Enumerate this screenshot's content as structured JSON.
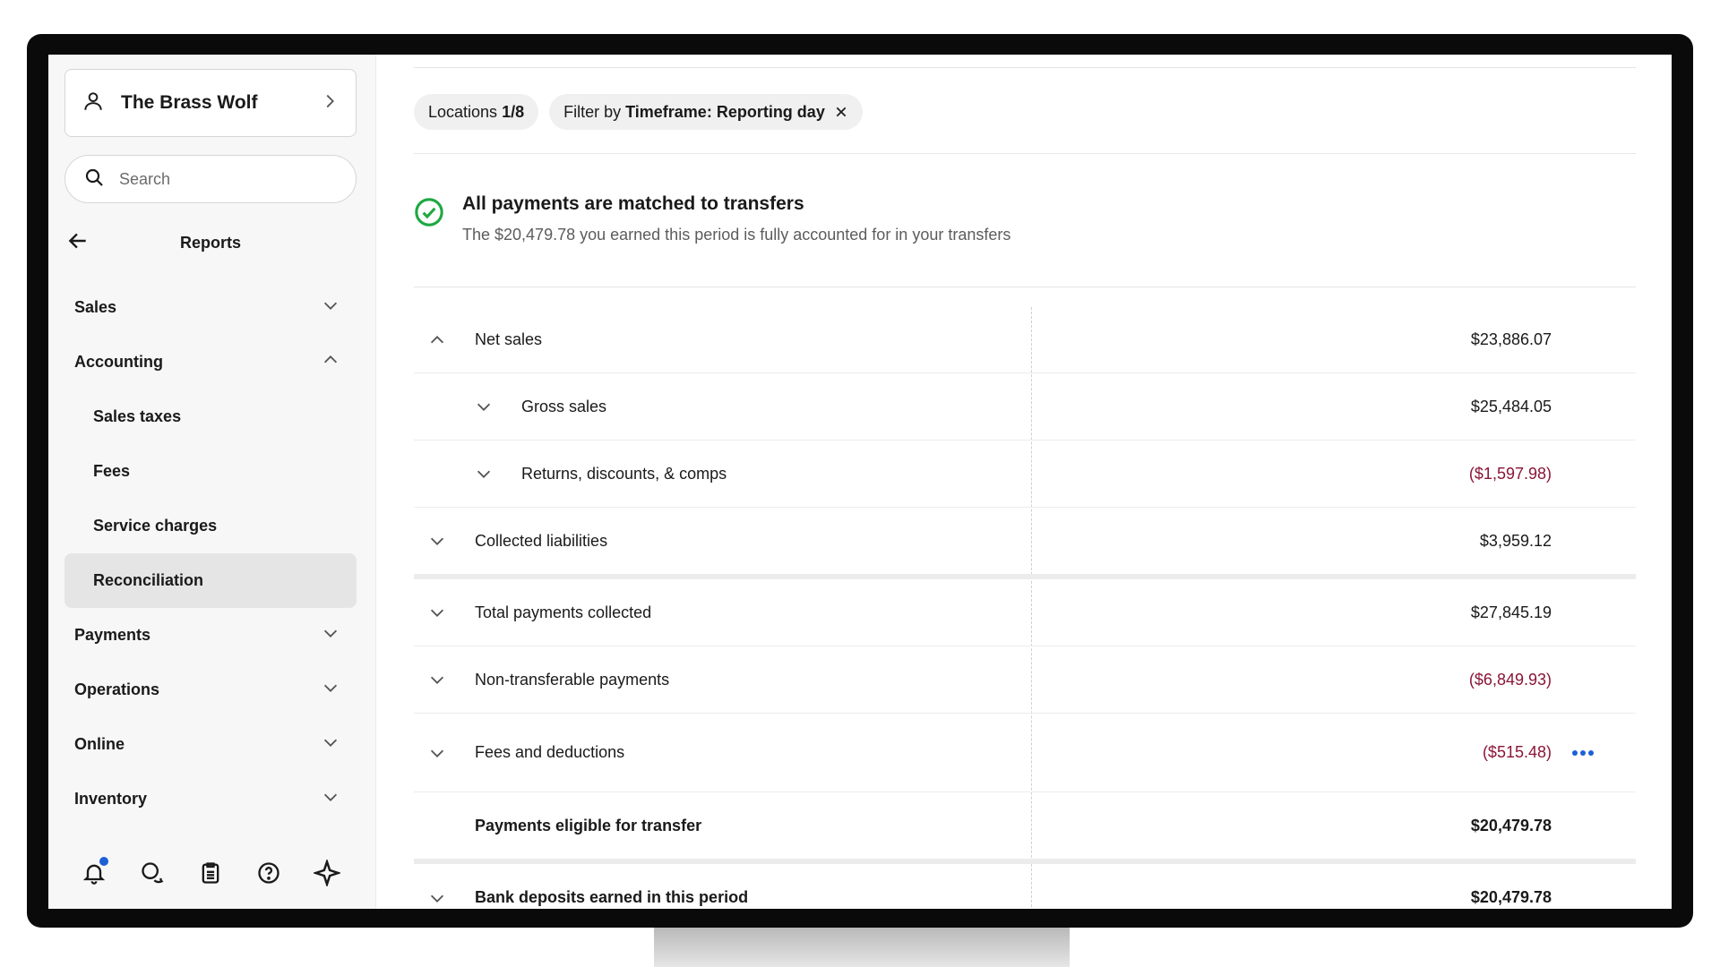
{
  "business": {
    "name": "The Brass Wolf"
  },
  "search": {
    "placeholder": "Search"
  },
  "reports": {
    "title": "Reports"
  },
  "nav": {
    "sales": "Sales",
    "accounting": "Accounting",
    "sub": [
      "Sales taxes",
      "Fees",
      "Service charges",
      "Reconciliation"
    ],
    "payments": "Payments",
    "operations": "Operations",
    "online": "Online",
    "inventory": "Inventory"
  },
  "filters": {
    "locations_label": "Locations",
    "locations_value": "1/8",
    "filter_prefix": "Filter by",
    "filter_value": "Timeframe: Reporting day"
  },
  "banner": {
    "title": "All payments are matched to transfers",
    "subtitle": "The $20,479.78 you earned this period is fully accounted for in your transfers",
    "status_color": "#1fa842"
  },
  "rows": [
    {
      "label": "Net sales",
      "amount": "$23,886.07"
    },
    {
      "label": "Gross sales",
      "amount": "$25,484.05"
    },
    {
      "label": "Returns, discounts, & comps",
      "amount": "($1,597.98)"
    },
    {
      "label": "Collected liabilities",
      "amount": "$3,959.12"
    },
    {
      "label": "Total payments collected",
      "amount": "$27,845.19"
    },
    {
      "label": "Non-transferable payments",
      "amount": "($6,849.93)"
    },
    {
      "label": "Fees and deductions",
      "amount": "($515.48)"
    },
    {
      "label": "Payments eligible for transfer",
      "amount": "$20,479.78"
    },
    {
      "label": "Bank deposits earned in this period",
      "amount": "$20,479.78"
    }
  ],
  "colors": {
    "negative": "#8a1538",
    "accent": "#1d5fd8"
  }
}
